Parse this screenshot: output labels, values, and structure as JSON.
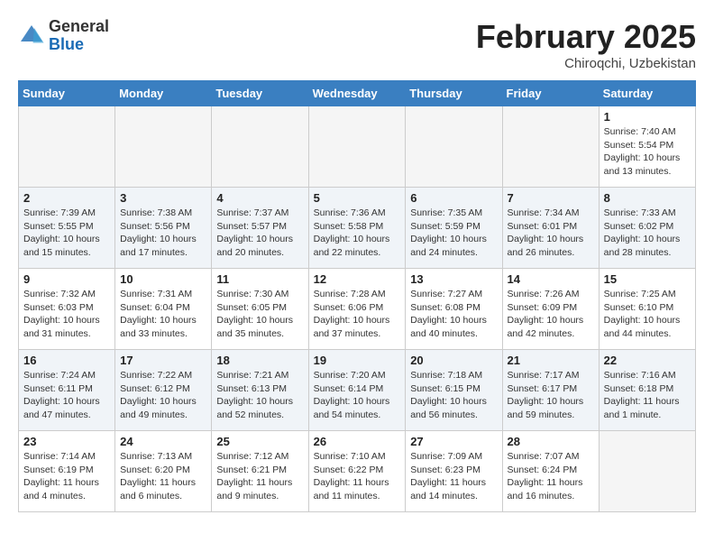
{
  "header": {
    "logo_general": "General",
    "logo_blue": "Blue",
    "month_title": "February 2025",
    "location": "Chiroqchi, Uzbekistan"
  },
  "days_of_week": [
    "Sunday",
    "Monday",
    "Tuesday",
    "Wednesday",
    "Thursday",
    "Friday",
    "Saturday"
  ],
  "weeks": [
    [
      {
        "day": "",
        "info": ""
      },
      {
        "day": "",
        "info": ""
      },
      {
        "day": "",
        "info": ""
      },
      {
        "day": "",
        "info": ""
      },
      {
        "day": "",
        "info": ""
      },
      {
        "day": "",
        "info": ""
      },
      {
        "day": "1",
        "info": "Sunrise: 7:40 AM\nSunset: 5:54 PM\nDaylight: 10 hours\nand 13 minutes."
      }
    ],
    [
      {
        "day": "2",
        "info": "Sunrise: 7:39 AM\nSunset: 5:55 PM\nDaylight: 10 hours\nand 15 minutes."
      },
      {
        "day": "3",
        "info": "Sunrise: 7:38 AM\nSunset: 5:56 PM\nDaylight: 10 hours\nand 17 minutes."
      },
      {
        "day": "4",
        "info": "Sunrise: 7:37 AM\nSunset: 5:57 PM\nDaylight: 10 hours\nand 20 minutes."
      },
      {
        "day": "5",
        "info": "Sunrise: 7:36 AM\nSunset: 5:58 PM\nDaylight: 10 hours\nand 22 minutes."
      },
      {
        "day": "6",
        "info": "Sunrise: 7:35 AM\nSunset: 5:59 PM\nDaylight: 10 hours\nand 24 minutes."
      },
      {
        "day": "7",
        "info": "Sunrise: 7:34 AM\nSunset: 6:01 PM\nDaylight: 10 hours\nand 26 minutes."
      },
      {
        "day": "8",
        "info": "Sunrise: 7:33 AM\nSunset: 6:02 PM\nDaylight: 10 hours\nand 28 minutes."
      }
    ],
    [
      {
        "day": "9",
        "info": "Sunrise: 7:32 AM\nSunset: 6:03 PM\nDaylight: 10 hours\nand 31 minutes."
      },
      {
        "day": "10",
        "info": "Sunrise: 7:31 AM\nSunset: 6:04 PM\nDaylight: 10 hours\nand 33 minutes."
      },
      {
        "day": "11",
        "info": "Sunrise: 7:30 AM\nSunset: 6:05 PM\nDaylight: 10 hours\nand 35 minutes."
      },
      {
        "day": "12",
        "info": "Sunrise: 7:28 AM\nSunset: 6:06 PM\nDaylight: 10 hours\nand 37 minutes."
      },
      {
        "day": "13",
        "info": "Sunrise: 7:27 AM\nSunset: 6:08 PM\nDaylight: 10 hours\nand 40 minutes."
      },
      {
        "day": "14",
        "info": "Sunrise: 7:26 AM\nSunset: 6:09 PM\nDaylight: 10 hours\nand 42 minutes."
      },
      {
        "day": "15",
        "info": "Sunrise: 7:25 AM\nSunset: 6:10 PM\nDaylight: 10 hours\nand 44 minutes."
      }
    ],
    [
      {
        "day": "16",
        "info": "Sunrise: 7:24 AM\nSunset: 6:11 PM\nDaylight: 10 hours\nand 47 minutes."
      },
      {
        "day": "17",
        "info": "Sunrise: 7:22 AM\nSunset: 6:12 PM\nDaylight: 10 hours\nand 49 minutes."
      },
      {
        "day": "18",
        "info": "Sunrise: 7:21 AM\nSunset: 6:13 PM\nDaylight: 10 hours\nand 52 minutes."
      },
      {
        "day": "19",
        "info": "Sunrise: 7:20 AM\nSunset: 6:14 PM\nDaylight: 10 hours\nand 54 minutes."
      },
      {
        "day": "20",
        "info": "Sunrise: 7:18 AM\nSunset: 6:15 PM\nDaylight: 10 hours\nand 56 minutes."
      },
      {
        "day": "21",
        "info": "Sunrise: 7:17 AM\nSunset: 6:17 PM\nDaylight: 10 hours\nand 59 minutes."
      },
      {
        "day": "22",
        "info": "Sunrise: 7:16 AM\nSunset: 6:18 PM\nDaylight: 11 hours\nand 1 minute."
      }
    ],
    [
      {
        "day": "23",
        "info": "Sunrise: 7:14 AM\nSunset: 6:19 PM\nDaylight: 11 hours\nand 4 minutes."
      },
      {
        "day": "24",
        "info": "Sunrise: 7:13 AM\nSunset: 6:20 PM\nDaylight: 11 hours\nand 6 minutes."
      },
      {
        "day": "25",
        "info": "Sunrise: 7:12 AM\nSunset: 6:21 PM\nDaylight: 11 hours\nand 9 minutes."
      },
      {
        "day": "26",
        "info": "Sunrise: 7:10 AM\nSunset: 6:22 PM\nDaylight: 11 hours\nand 11 minutes."
      },
      {
        "day": "27",
        "info": "Sunrise: 7:09 AM\nSunset: 6:23 PM\nDaylight: 11 hours\nand 14 minutes."
      },
      {
        "day": "28",
        "info": "Sunrise: 7:07 AM\nSunset: 6:24 PM\nDaylight: 11 hours\nand 16 minutes."
      },
      {
        "day": "",
        "info": ""
      }
    ]
  ]
}
